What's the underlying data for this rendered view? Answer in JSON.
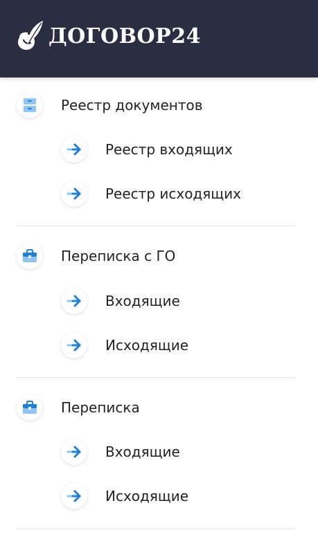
{
  "header": {
    "brand_name": "ДОГОВОР24",
    "logo_icon": "feather-ink-logo-icon",
    "background": "#2b2d42"
  },
  "menu": {
    "sections": [
      {
        "label": "Реестр документов",
        "icon": "filing-cabinet-icon",
        "items": [
          {
            "label": "Реестр входящих",
            "icon": "arrow-right-icon"
          },
          {
            "label": "Реестр исходящих",
            "icon": "arrow-right-icon"
          }
        ]
      },
      {
        "label": "Переписка с ГО",
        "icon": "briefcase-icon",
        "items": [
          {
            "label": "Входящие",
            "icon": "arrow-right-icon"
          },
          {
            "label": "Исходящие",
            "icon": "arrow-right-icon"
          }
        ]
      },
      {
        "label": "Переписка",
        "icon": "briefcase-icon",
        "items": [
          {
            "label": "Входящие",
            "icon": "arrow-right-icon"
          },
          {
            "label": "Исходящие",
            "icon": "arrow-right-icon"
          }
        ]
      }
    ],
    "accent_color": "#1e7fd8",
    "icon_light_color": "#8ec5f2"
  }
}
